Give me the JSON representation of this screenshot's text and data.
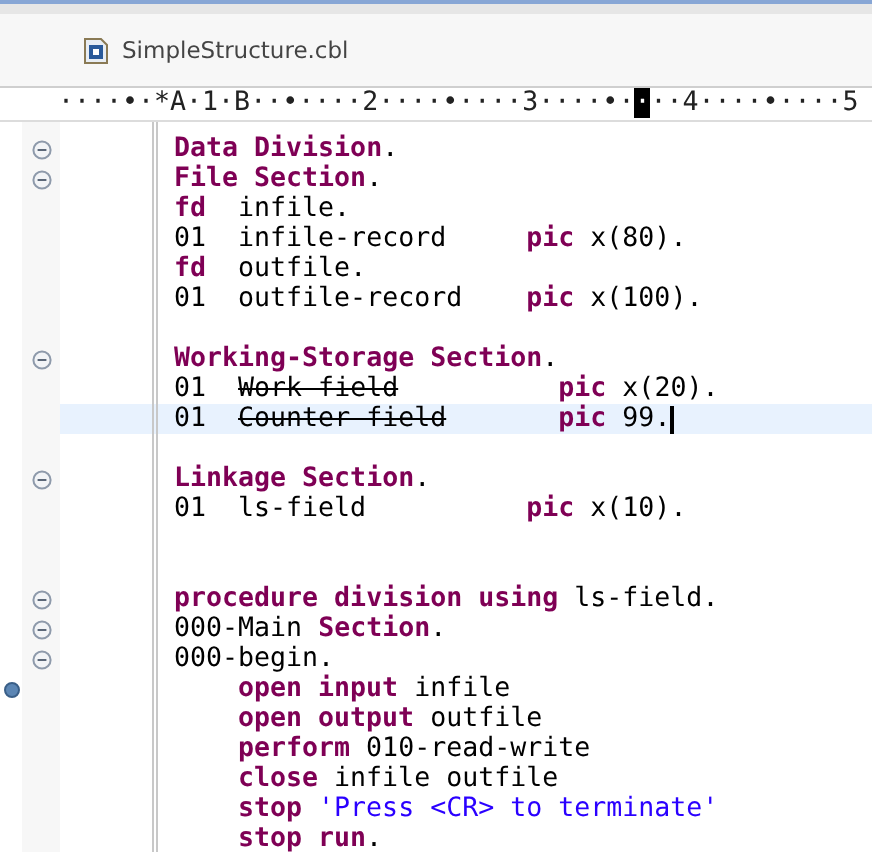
{
  "tab": {
    "title": "SimpleStructure.cbl"
  },
  "ruler": [
    {
      "text": "····•·*A·1·B··•····2····•····3····•·",
      "cursor": false
    },
    {
      "text": "·",
      "cursor": true
    },
    {
      "text": "··4····•····5",
      "cursor": false
    }
  ],
  "lines": [
    {
      "fold": true,
      "marker": false,
      "current": false,
      "indent": false,
      "segments": [
        {
          "kind": "keyword",
          "text": "Data Division"
        },
        {
          "kind": "plain",
          "text": "."
        }
      ]
    },
    {
      "fold": true,
      "marker": false,
      "current": false,
      "indent": false,
      "segments": [
        {
          "kind": "keyword",
          "text": "File Section"
        },
        {
          "kind": "plain",
          "text": "."
        }
      ]
    },
    {
      "fold": false,
      "marker": false,
      "current": false,
      "indent": false,
      "segments": [
        {
          "kind": "keyword",
          "text": "fd"
        },
        {
          "kind": "plain",
          "text": "  infile."
        }
      ]
    },
    {
      "fold": false,
      "marker": false,
      "current": false,
      "indent": false,
      "segments": [
        {
          "kind": "plain",
          "text": "01  infile-record     "
        },
        {
          "kind": "keyword",
          "text": "pic"
        },
        {
          "kind": "plain",
          "text": " x(80)."
        }
      ]
    },
    {
      "fold": false,
      "marker": false,
      "current": false,
      "indent": false,
      "segments": [
        {
          "kind": "keyword",
          "text": "fd"
        },
        {
          "kind": "plain",
          "text": "  outfile."
        }
      ]
    },
    {
      "fold": false,
      "marker": false,
      "current": false,
      "indent": false,
      "segments": [
        {
          "kind": "plain",
          "text": "01  outfile-record    "
        },
        {
          "kind": "keyword",
          "text": "pic"
        },
        {
          "kind": "plain",
          "text": " x(100)."
        }
      ]
    },
    {
      "fold": false,
      "marker": false,
      "current": false
    },
    {
      "fold": true,
      "marker": false,
      "current": false,
      "indent": false,
      "segments": [
        {
          "kind": "keyword",
          "text": "Working-Storage Section"
        },
        {
          "kind": "plain",
          "text": "."
        }
      ]
    },
    {
      "fold": false,
      "marker": false,
      "current": false,
      "indent": false,
      "segments": [
        {
          "kind": "plain",
          "text": "01  "
        },
        {
          "kind": "strike",
          "text": "Work field"
        },
        {
          "kind": "keyword",
          "text": "          pic"
        },
        {
          "kind": "plain",
          "text": " x(20)."
        }
      ]
    },
    {
      "fold": false,
      "marker": false,
      "current": true,
      "indent": false,
      "segments": [
        {
          "kind": "plain",
          "text": "01  "
        },
        {
          "kind": "strike",
          "text": "Counter field"
        },
        {
          "kind": "keyword",
          "text": "       pic"
        },
        {
          "kind": "plain",
          "text": " 99."
        }
      ]
    },
    {
      "fold": false,
      "marker": false,
      "current": false
    },
    {
      "fold": true,
      "marker": false,
      "current": false,
      "indent": false,
      "segments": [
        {
          "kind": "keyword",
          "text": "Linkage Section"
        },
        {
          "kind": "plain",
          "text": "."
        }
      ]
    },
    {
      "fold": false,
      "marker": false,
      "current": false,
      "indent": false,
      "segments": [
        {
          "kind": "plain",
          "text": "01  ls-field          "
        },
        {
          "kind": "keyword",
          "text": "pic"
        },
        {
          "kind": "plain",
          "text": " x(10)."
        }
      ]
    },
    {
      "fold": false,
      "marker": false,
      "current": false
    },
    {
      "fold": false,
      "marker": false,
      "current": false
    },
    {
      "fold": true,
      "marker": false,
      "current": false,
      "indent": false,
      "segments": [
        {
          "kind": "keyword",
          "text": "procedure division using"
        },
        {
          "kind": "plain",
          "text": " ls-field."
        }
      ]
    },
    {
      "fold": true,
      "marker": false,
      "current": false,
      "indent": false,
      "segments": [
        {
          "kind": "plain",
          "text": "000-Main "
        },
        {
          "kind": "keyword",
          "text": "Section"
        },
        {
          "kind": "plain",
          "text": "."
        }
      ]
    },
    {
      "fold": true,
      "marker": false,
      "current": false,
      "indent": false,
      "segments": [
        {
          "kind": "plain",
          "text": "000-begin."
        }
      ]
    },
    {
      "fold": false,
      "marker": true,
      "current": false,
      "indent": true,
      "segments": [
        {
          "kind": "keyword",
          "text": "open input"
        },
        {
          "kind": "plain",
          "text": " infile"
        }
      ]
    },
    {
      "fold": false,
      "marker": false,
      "current": false,
      "indent": true,
      "segments": [
        {
          "kind": "keyword",
          "text": "open output"
        },
        {
          "kind": "plain",
          "text": " outfile"
        }
      ]
    },
    {
      "fold": false,
      "marker": false,
      "current": false,
      "indent": true,
      "segments": [
        {
          "kind": "keyword",
          "text": "perform"
        },
        {
          "kind": "plain",
          "text": " 010-read-write"
        }
      ]
    },
    {
      "fold": false,
      "marker": false,
      "current": false,
      "indent": true,
      "segments": [
        {
          "kind": "keyword",
          "text": "close"
        },
        {
          "kind": "plain",
          "text": " infile outfile"
        }
      ]
    },
    {
      "fold": false,
      "marker": false,
      "current": false,
      "indent": true,
      "segments": [
        {
          "kind": "keyword",
          "text": "stop"
        },
        {
          "kind": "string",
          "text": " 'Press <CR> to terminate'"
        }
      ]
    },
    {
      "fold": false,
      "marker": false,
      "current": false,
      "indent": true,
      "segments": [
        {
          "kind": "keyword",
          "text": "stop run"
        },
        {
          "kind": "plain",
          "text": "."
        }
      ]
    }
  ]
}
